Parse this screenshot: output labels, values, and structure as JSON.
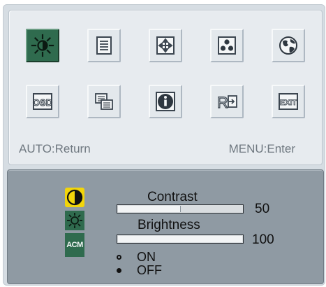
{
  "menu": {
    "icons_row1": [
      {
        "name": "luminance-icon",
        "selected": true
      },
      {
        "name": "image-setup-icon"
      },
      {
        "name": "image-position-icon"
      },
      {
        "name": "color-temperature-icon"
      },
      {
        "name": "language-icon"
      }
    ],
    "icons_row2": [
      {
        "name": "osd-icon",
        "text": "OSD"
      },
      {
        "name": "pc-setup-icon"
      },
      {
        "name": "information-icon"
      },
      {
        "name": "reset-icon",
        "text": "R"
      },
      {
        "name": "exit-icon",
        "text": "EXIT"
      }
    ],
    "hint_left": "AUTO:Return",
    "hint_right": "MENU:Enter"
  },
  "settings": {
    "contrast": {
      "label": "Contrast",
      "value": "50",
      "fill_fraction": 0.5
    },
    "brightness": {
      "label": "Brightness",
      "value": "100",
      "fill_fraction": 1.0
    },
    "acm": {
      "icon_text": "ACM",
      "options": [
        {
          "label": "ON",
          "selected": false
        },
        {
          "label": "OFF",
          "selected": true
        }
      ]
    }
  },
  "colors": {
    "selected_tile": "#2f6b4e",
    "contrast_icon_bg": "#f2d50a",
    "panel_bottom": "#8f9aa3"
  }
}
